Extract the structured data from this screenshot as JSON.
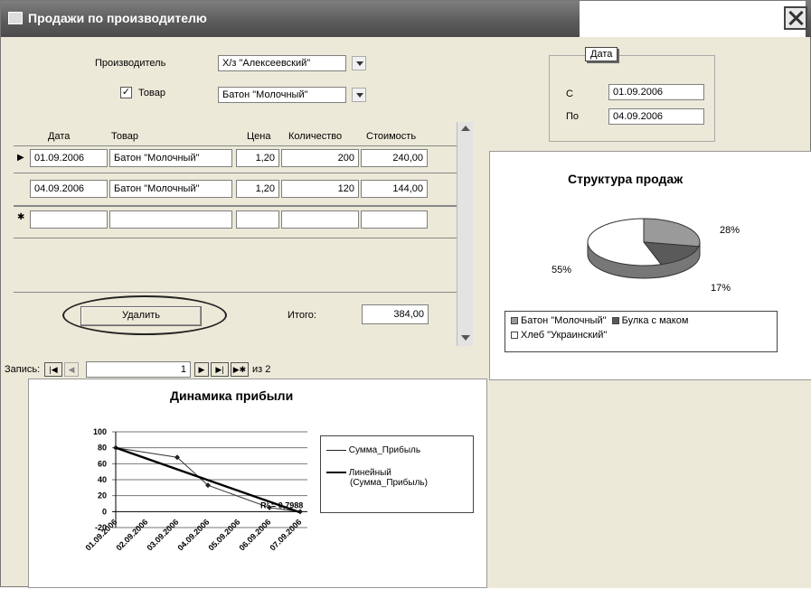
{
  "window": {
    "title": "Продажи по производителю"
  },
  "filters": {
    "producer_label": "Производитель",
    "producer_value": "Х/з \"Алексеевский\"",
    "product_checkbox_checked": true,
    "product_label": "Товар",
    "product_value": "Батон \"Молочный\""
  },
  "date_group": {
    "legend": "Дата",
    "from_label": "С",
    "from_value": "01.09.2006",
    "to_label": "По",
    "to_value": "04.09.2006"
  },
  "table": {
    "columns": [
      "Дата",
      "Товар",
      "Цена",
      "Количество",
      "Стоимость"
    ],
    "rows": [
      {
        "date": "01.09.2006",
        "product": "Батон \"Молочный\"",
        "price": "1,20",
        "qty": "200",
        "cost": "240,00"
      },
      {
        "date": "04.09.2006",
        "product": "Батон \"Молочный\"",
        "price": "1,20",
        "qty": "120",
        "cost": "144,00"
      }
    ],
    "delete_button": "Удалить",
    "total_label": "Итого:",
    "total_value": "384,00"
  },
  "navigator": {
    "record_label": "Запись:",
    "current": "1",
    "of_text": "из 2"
  },
  "pie_chart": {
    "title": "Структура продаж",
    "chart_data": {
      "type": "pie",
      "title": "Структура продаж",
      "slices": [
        {
          "name": "Батон \"Молочный\"",
          "value": 28,
          "label": "28%",
          "color": "#9a9a9a"
        },
        {
          "name": "Булка с маком",
          "value": 17,
          "label": "17%",
          "color": "#5a5a5a"
        },
        {
          "name": "Хлеб \"Украинский\"",
          "value": 55,
          "label": "55%",
          "color": "#ffffff"
        }
      ]
    },
    "legend": [
      "Батон \"Молочный\"",
      "Булка с маком",
      "Хлеб \"Украинский\""
    ]
  },
  "line_chart": {
    "title": "Динамика прибыли",
    "chart_data": {
      "type": "line",
      "title": "Динамика прибыли",
      "x": [
        "01.09.2006",
        "02.09.2006",
        "03.09.2006",
        "04.09.2006",
        "05.09.2006",
        "06.09.2006",
        "07.09.2006"
      ],
      "yticks": [
        100,
        80,
        60,
        40,
        20,
        0,
        -20
      ],
      "ylim": [
        -20,
        100
      ],
      "series": [
        {
          "name": "Сумма_Прибыль",
          "points": [
            [
              1,
              80
            ],
            [
              3,
              68
            ],
            [
              4,
              33
            ],
            [
              6,
              5
            ],
            [
              7,
              0
            ]
          ]
        },
        {
          "name": "Линейный (Сумма_Прибыль)",
          "trend": [
            [
              1,
              80
            ],
            [
              7,
              -1
            ]
          ]
        }
      ],
      "annotation": "R² = 0,7988"
    },
    "legend": [
      "Сумма_Прибыль",
      "Линейный",
      "(Сумма_Прибыль)"
    ]
  }
}
